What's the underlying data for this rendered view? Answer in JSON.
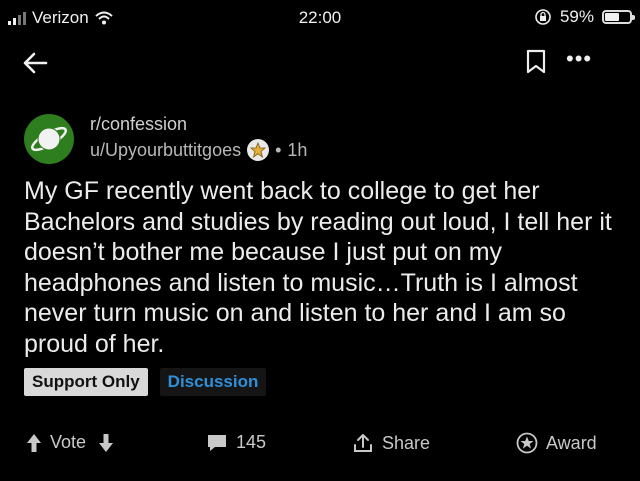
{
  "status_bar": {
    "carrier": "Verizon",
    "time": "22:00",
    "battery_percent": "59%",
    "battery_level": 0.59
  },
  "top_bar": {
    "back_icon": "arrow-left-icon",
    "save_icon": "bookmark-icon",
    "more_icon": "more-horizontal-icon"
  },
  "post": {
    "subreddit": "r/confession",
    "author": "u/Upyourbuttitgoes",
    "separator": "•",
    "time_ago": "1h",
    "title": "My GF recently went back to college to get her Bachelors and studies by reading out loud, I tell her it doesn’t bother me because I just put on my headphones and listen to music…Truth is I almost never turn music on and listen to her and I am so proud of her.",
    "flairs": [
      "Support Only",
      "Discussion"
    ]
  },
  "actions": {
    "vote_label": "Vote",
    "comments_count": "145",
    "share_label": "Share",
    "award_label": "Award"
  },
  "colors": {
    "background": "#000000",
    "subreddit_icon": "#2e7d1f",
    "discussion_flair": "#2f8fd9",
    "support_flair_bg": "#d9d9d9"
  }
}
